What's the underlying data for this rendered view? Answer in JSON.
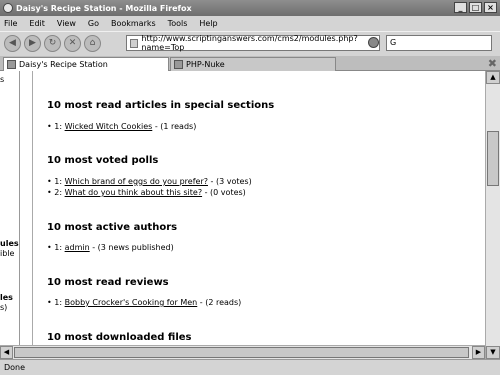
{
  "window": {
    "title": "Daisy's Recipe Station - Mozilla Firefox"
  },
  "menu": [
    "File",
    "Edit",
    "View",
    "Go",
    "Bookmarks",
    "Tools",
    "Help"
  ],
  "address": {
    "url": "http://www.scriptinganswers.com/cms2/modules.php?name=Top"
  },
  "search": {
    "value": "G"
  },
  "tabs": [
    {
      "label": "Daisy's Recipe Station"
    },
    {
      "label": "PHP-Nuke"
    }
  ],
  "left_fragments": [
    "s",
    "ules",
    "ible",
    "les",
    "s)"
  ],
  "sections": [
    {
      "title": "10 most read articles in special sections",
      "rows": [
        {
          "num": "1:",
          "link": "Wicked Witch Cookies",
          "suffix": "- (1 reads)"
        }
      ]
    },
    {
      "title": "10 most voted polls",
      "rows": [
        {
          "num": "1:",
          "link": "Which brand of eggs do you prefer?",
          "suffix": "- (3 votes)"
        },
        {
          "num": "2:",
          "link": "What do you think about this site?",
          "suffix": "- (0 votes)"
        }
      ]
    },
    {
      "title": "10 most active authors",
      "rows": [
        {
          "num": "1:",
          "link": "admin",
          "suffix": "- (3 news published)"
        }
      ]
    },
    {
      "title": "10 most read reviews",
      "rows": [
        {
          "num": "1:",
          "link": "Bobby Crocker's Cooking for Men",
          "suffix": "- (2 reads)"
        }
      ]
    },
    {
      "title": "10 most downloaded files",
      "rows": []
    }
  ],
  "status": {
    "text": "Done"
  }
}
